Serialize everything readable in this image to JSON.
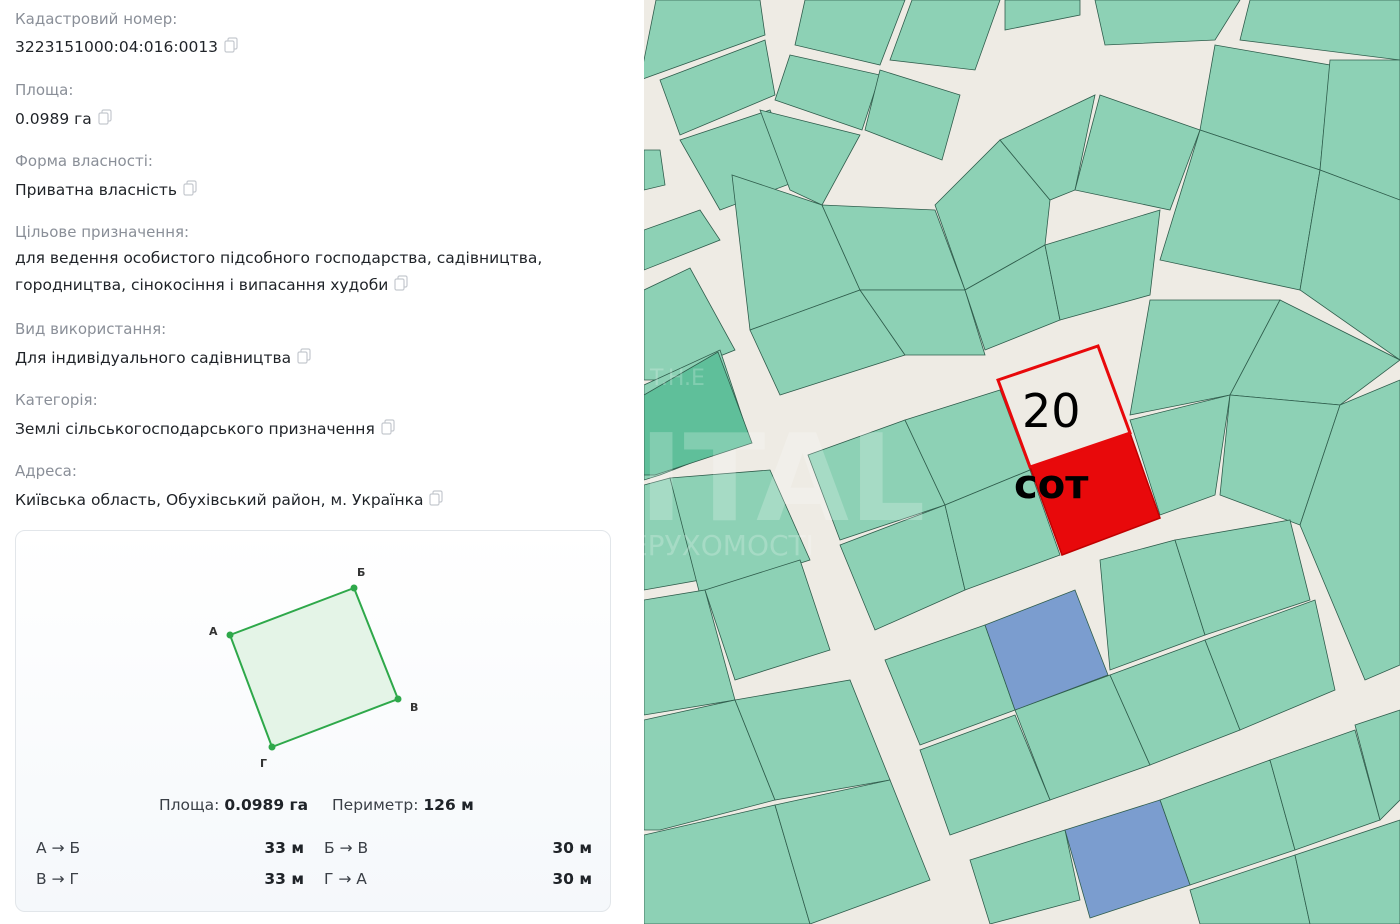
{
  "fields": [
    {
      "label": "Кадастровий номер:",
      "value": "3223151000:04:016:0013"
    },
    {
      "label": "Площа:",
      "value": "0.0989 га"
    },
    {
      "label": "Форма власності:",
      "value": "Приватна власність"
    },
    {
      "label": "Цільове призначення:",
      "value_lines": [
        "для ведення особистого підсобного господарства, садівництва,",
        "городництва, сінокосіння і випасання худоби"
      ]
    },
    {
      "label": "Вид використання:",
      "value": "Для індивідуального садівництва"
    },
    {
      "label": "Категорія:",
      "value": "Землі сільськогосподарського призначення"
    },
    {
      "label": "Адреса:",
      "value": "Київська область, Обухівський район, м. Українка"
    }
  ],
  "plan": {
    "vertices": [
      "А",
      "Б",
      "В",
      "Г"
    ],
    "area_label": "Площа:",
    "area_value": "0.0989 га",
    "perimeter_label": "Периметр:",
    "perimeter_value": "126 м",
    "sides": [
      {
        "from": "А → Б",
        "length": "33 м"
      },
      {
        "from": "Б → В",
        "length": "30 м"
      },
      {
        "from": "В → Г",
        "length": "33 м"
      },
      {
        "from": "Г → А",
        "length": "30 м"
      }
    ]
  },
  "map": {
    "plot_number": "20",
    "plot_unit": "сот",
    "watermark_top": "T.H.E",
    "watermark_main": "CAPITAL",
    "watermark_sub": "АГЕНТСТВО НЕРУХОМОСТІ",
    "colors": {
      "parcel": "#8dd1b5",
      "road": "#eeebe4",
      "highlight": "#e8090b",
      "blue_parcel": "#7b9dcf"
    }
  }
}
